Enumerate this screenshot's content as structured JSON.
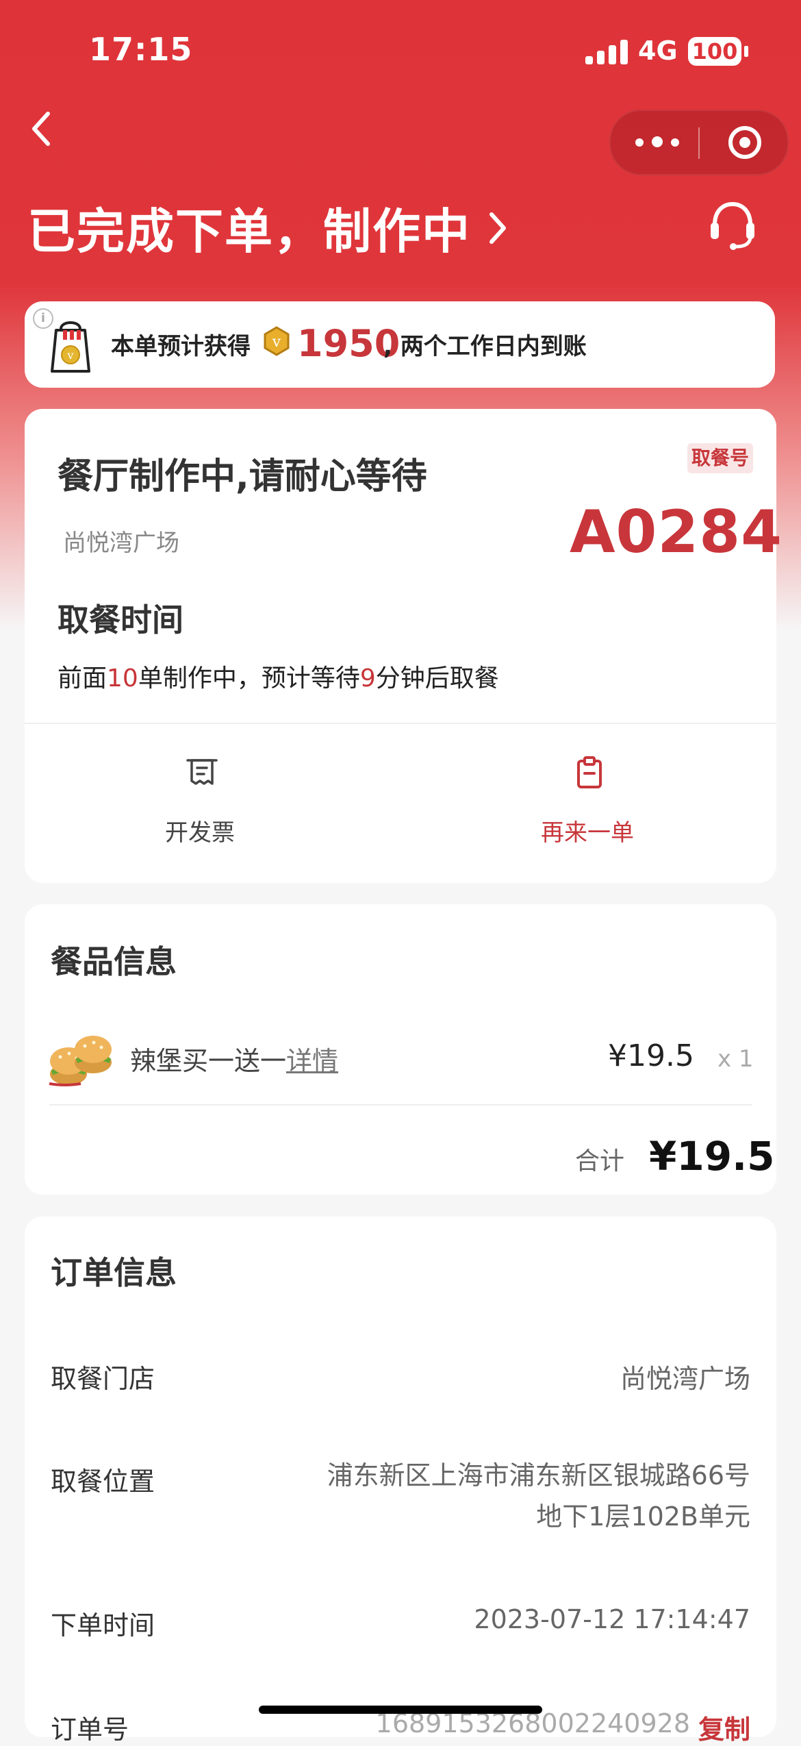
{
  "statusbar": {
    "time": "17:15",
    "network": "4G",
    "battery": "100"
  },
  "header": {
    "title": "已完成下单，制作中",
    "back_icon": "back-chevron-icon",
    "more_icon": "more-icon",
    "target_icon": "target-icon",
    "support_icon": "customer-service-icon"
  },
  "reward": {
    "prefix": "本单预计获得",
    "points": "1950",
    "suffix": ", 两个工作日内到账",
    "info_icon": "info-icon",
    "bag_icon": "reward-bag-icon",
    "coin_icon": "points-coin-icon"
  },
  "status": {
    "title": "餐厅制作中,请耐心等待",
    "store": "尚悦湾广场",
    "pickup_label": "取餐号",
    "pickup_code": "A0284",
    "pickup_time_title": "取餐时间",
    "queue_prefix": "前面",
    "queue_count": "10",
    "queue_middle": "单制作中，预计等待",
    "wait_minutes": "9",
    "queue_suffix": "分钟后取餐"
  },
  "actions": [
    {
      "label": "开发票",
      "icon": "invoice-icon"
    },
    {
      "label": "再来一单",
      "icon": "reorder-clipboard-icon"
    }
  ],
  "food": {
    "title": "餐品信息",
    "item_name": "辣堡买一送一",
    "detail_link": "详情",
    "price": "¥19.5",
    "quantity": "x 1",
    "total_label": "合计",
    "total_price": "¥19.5",
    "image_icon": "burger-image"
  },
  "order": {
    "title": "订单信息",
    "rows": [
      {
        "label": "取餐门店",
        "value": "尚悦湾广场"
      },
      {
        "label": "取餐位置",
        "value_line1": "浦东新区上海市浦东新区银城路66号",
        "value_line2": "地下1层102B单元"
      },
      {
        "label": "下单时间",
        "value": "2023-07-12 17:14:47"
      },
      {
        "label": "订单号",
        "value": "1689153268002240928",
        "action": "复制"
      }
    ]
  },
  "colors": {
    "brand_red": "#de3339",
    "accent_red": "#c7363a",
    "background": "#f6f6f6",
    "card": "#ffffff"
  }
}
